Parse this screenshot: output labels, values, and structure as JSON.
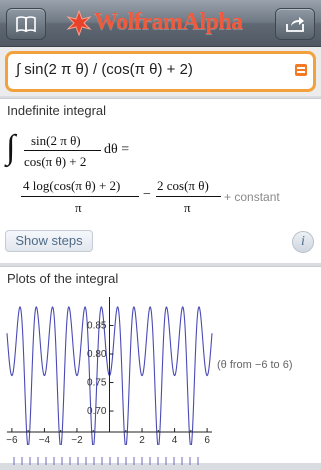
{
  "brand": {
    "name": "WolframAlpha"
  },
  "toolbar": {
    "left_icon": "book-icon",
    "right_icon": "share-icon"
  },
  "query": {
    "value": "∫ sin(2 π θ) / (cos(π θ) + 2)"
  },
  "pods": [
    {
      "title": "Indefinite integral",
      "integral_sign": "∫",
      "integrand_num": "sin(2 π θ)",
      "integrand_den": "cos(π θ) + 2",
      "d_theta": "dθ =",
      "term1_num": "4 log(cos(π θ) + 2)",
      "term1_den": "π",
      "minus": "−",
      "term2_num": "2 cos(π θ)",
      "term2_den": "π",
      "constant": "+ constant",
      "show_steps": "Show steps",
      "info": "i"
    },
    {
      "title": "Plots of the integral",
      "note": "(θ from −6 to 6)"
    }
  ],
  "chart_data": {
    "type": "line",
    "title": "",
    "xlabel": "",
    "ylabel": "",
    "xlim": [
      -6.3,
      6.3
    ],
    "ylim": [
      0.665,
      0.9
    ],
    "x_ticks": [
      -6,
      -4,
      -2,
      2,
      4,
      6
    ],
    "x_tick_labels": [
      "−6",
      "−4",
      "−2",
      "2",
      "4",
      "6"
    ],
    "y_ticks": [
      0.7,
      0.75,
      0.8,
      0.85
    ],
    "y_tick_labels": [
      "0.70",
      "0.75",
      "0.80",
      "0.85"
    ],
    "series": [
      {
        "color": "#4a4ab5",
        "function": "4*log(cos(pi*t)+2)/pi - 2*cos(pi*t)/pi"
      }
    ]
  }
}
